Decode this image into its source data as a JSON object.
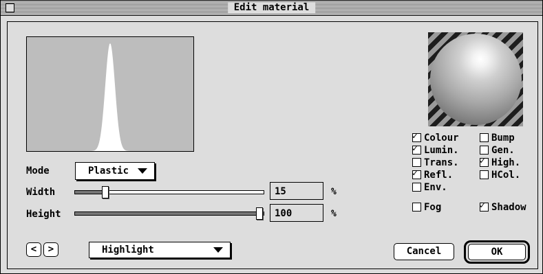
{
  "window": {
    "title": "Edit material"
  },
  "left": {
    "mode": {
      "label": "Mode",
      "value": "Plastic"
    },
    "width": {
      "label": "Width",
      "value": 15,
      "display": "15",
      "unit": "%"
    },
    "height": {
      "label": "Height",
      "value": 100,
      "display": "100",
      "unit": "%"
    }
  },
  "checkboxes": [
    {
      "label": "Colour",
      "checked": true,
      "check_mark": "✓"
    },
    {
      "label": "Bump",
      "checked": false,
      "check_mark": ""
    },
    {
      "label": "Lumin.",
      "checked": true,
      "check_mark": "✓"
    },
    {
      "label": "Gen.",
      "checked": false,
      "check_mark": ""
    },
    {
      "label": "Trans.",
      "checked": false,
      "check_mark": ""
    },
    {
      "label": "High.",
      "checked": true,
      "check_mark": "✓"
    },
    {
      "label": "Refl.",
      "checked": true,
      "check_mark": "✓"
    },
    {
      "label": "HCol.",
      "checked": false,
      "check_mark": ""
    },
    {
      "label": "Env.",
      "checked": false,
      "check_mark": ""
    },
    {
      "label": "Fog",
      "checked": false,
      "check_mark": ""
    },
    {
      "label": "Shadow",
      "checked": true,
      "check_mark": "✓"
    }
  ],
  "bottom": {
    "prev_label": "<",
    "next_label": ">",
    "page_select": "Highlight",
    "cancel_label": "Cancel",
    "ok_label": "OK"
  },
  "colors": {
    "background": "#dddddd",
    "graph": "#bdbdbd"
  }
}
